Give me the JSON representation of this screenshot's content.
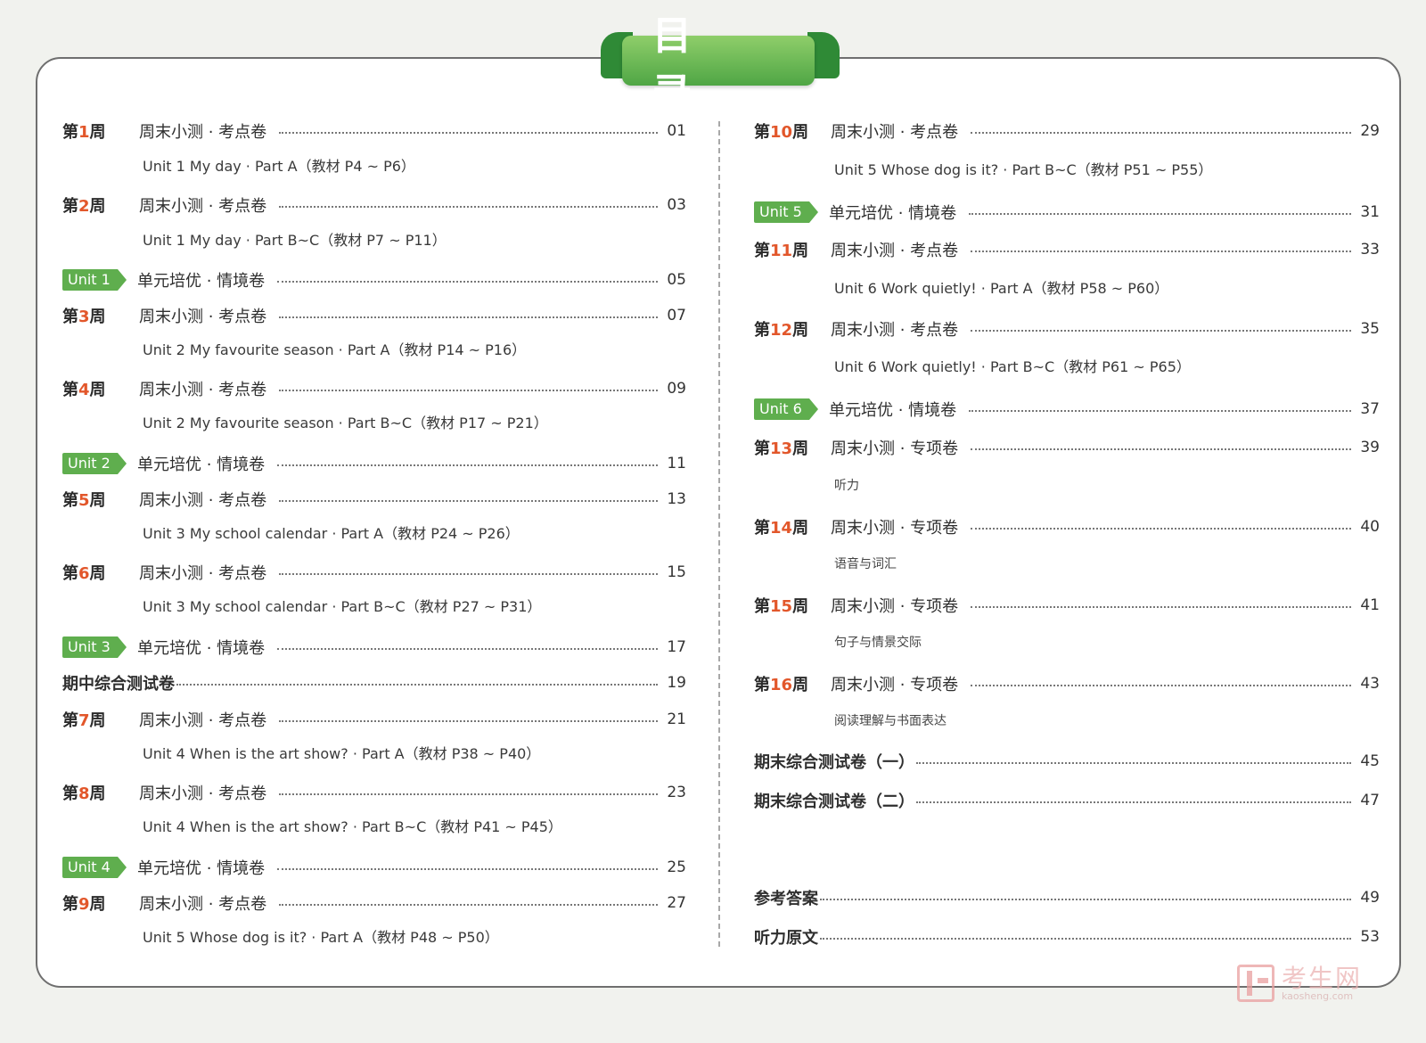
{
  "title": "目 录",
  "left": [
    {
      "type": "week",
      "pre": "第",
      "num": "1",
      "suf": "周",
      "title": "周末小测 · 考点卷",
      "page": "01",
      "sub": "Unit 1  My day · Part A（教材 P4 ~ P6）"
    },
    {
      "type": "week",
      "pre": "第",
      "num": "2",
      "suf": "周",
      "title": "周末小测 · 考点卷",
      "page": "03",
      "sub": "Unit 1  My day · Part B~C（教材 P7 ~ P11）"
    },
    {
      "type": "unit",
      "badge": "Unit 1",
      "title": "单元培优 · 情境卷",
      "page": "05"
    },
    {
      "type": "week",
      "pre": "第",
      "num": "3",
      "suf": "周",
      "title": "周末小测 · 考点卷",
      "page": "07",
      "sub": "Unit 2  My favourite season · Part A（教材 P14 ~ P16）"
    },
    {
      "type": "week",
      "pre": "第",
      "num": "4",
      "suf": "周",
      "title": "周末小测 · 考点卷",
      "page": "09",
      "sub": "Unit 2  My favourite season · Part B~C（教材 P17 ~ P21）"
    },
    {
      "type": "unit",
      "badge": "Unit 2",
      "title": "单元培优 · 情境卷",
      "page": "11"
    },
    {
      "type": "week",
      "pre": "第",
      "num": "5",
      "suf": "周",
      "title": "周末小测 · 考点卷",
      "page": "13",
      "sub": "Unit 3  My school calendar · Part A（教材 P24 ~ P26）"
    },
    {
      "type": "week",
      "pre": "第",
      "num": "6",
      "suf": "周",
      "title": "周末小测 · 考点卷",
      "page": "15",
      "sub": "Unit 3  My school calendar · Part B~C（教材 P27 ~ P31）"
    },
    {
      "type": "unit",
      "badge": "Unit 3",
      "title": "单元培优 · 情境卷",
      "page": "17"
    },
    {
      "type": "plain",
      "title": "期中综合测试卷",
      "page": "19"
    },
    {
      "type": "week",
      "pre": "第",
      "num": "7",
      "suf": "周",
      "title": "周末小测 · 考点卷",
      "page": "21",
      "sub": "Unit 4  When is the art show? · Part A（教材 P38 ~ P40）"
    },
    {
      "type": "week",
      "pre": "第",
      "num": "8",
      "suf": "周",
      "title": "周末小测 · 考点卷",
      "page": "23",
      "sub": "Unit 4  When is the art show? · Part B~C（教材 P41 ~ P45）"
    },
    {
      "type": "unit",
      "badge": "Unit 4",
      "title": "单元培优 · 情境卷",
      "page": "25"
    },
    {
      "type": "week",
      "pre": "第",
      "num": "9",
      "suf": "周",
      "title": "周末小测 · 考点卷",
      "page": "27",
      "sub": "Unit 5  Whose dog is it? · Part A（教材 P48 ~ P50）"
    }
  ],
  "right": [
    {
      "type": "week",
      "pre": "第",
      "num": "10",
      "suf": "周",
      "title": "周末小测 · 考点卷",
      "page": "29",
      "sub": "Unit 5  Whose dog is it? · Part B~C（教材 P51 ~ P55）"
    },
    {
      "type": "unit",
      "badge": "Unit 5",
      "title": "单元培优 · 情境卷",
      "page": "31"
    },
    {
      "type": "week",
      "pre": "第",
      "num": "11",
      "suf": "周",
      "title": "周末小测 · 考点卷",
      "page": "33",
      "sub": "Unit 6  Work quietly! · Part A（教材 P58 ~ P60）"
    },
    {
      "type": "week",
      "pre": "第",
      "num": "12",
      "suf": "周",
      "title": "周末小测 · 考点卷",
      "page": "35",
      "sub": "Unit 6  Work quietly! · Part B~C（教材 P61 ~ P65）"
    },
    {
      "type": "unit",
      "badge": "Unit 6",
      "title": "单元培优 · 情境卷",
      "page": "37"
    },
    {
      "type": "week",
      "pre": "第",
      "num": "13",
      "suf": "周",
      "title": "周末小测 · 专项卷",
      "page": "39",
      "sub": "听力",
      "subcn": true
    },
    {
      "type": "week",
      "pre": "第",
      "num": "14",
      "suf": "周",
      "title": "周末小测 · 专项卷",
      "page": "40",
      "sub": "语音与词汇",
      "subcn": true
    },
    {
      "type": "week",
      "pre": "第",
      "num": "15",
      "suf": "周",
      "title": "周末小测 · 专项卷",
      "page": "41",
      "sub": "句子与情景交际",
      "subcn": true
    },
    {
      "type": "week",
      "pre": "第",
      "num": "16",
      "suf": "周",
      "title": "周末小测 · 专项卷",
      "page": "43",
      "sub": "阅读理解与书面表达",
      "subcn": true
    },
    {
      "type": "plain",
      "title": "期末综合测试卷（一）",
      "page": "45"
    },
    {
      "type": "plain",
      "title": "期末综合测试卷（二）",
      "page": "47"
    },
    {
      "type": "plain",
      "title": "参考答案",
      "page": "49"
    },
    {
      "type": "plain",
      "title": "听力原文",
      "page": "53"
    }
  ],
  "watermark": {
    "cn": "考生网",
    "en": "kaosheng.com"
  },
  "colors": {
    "accent_green": "#5fae4e",
    "accent_orange": "#e2572b"
  }
}
